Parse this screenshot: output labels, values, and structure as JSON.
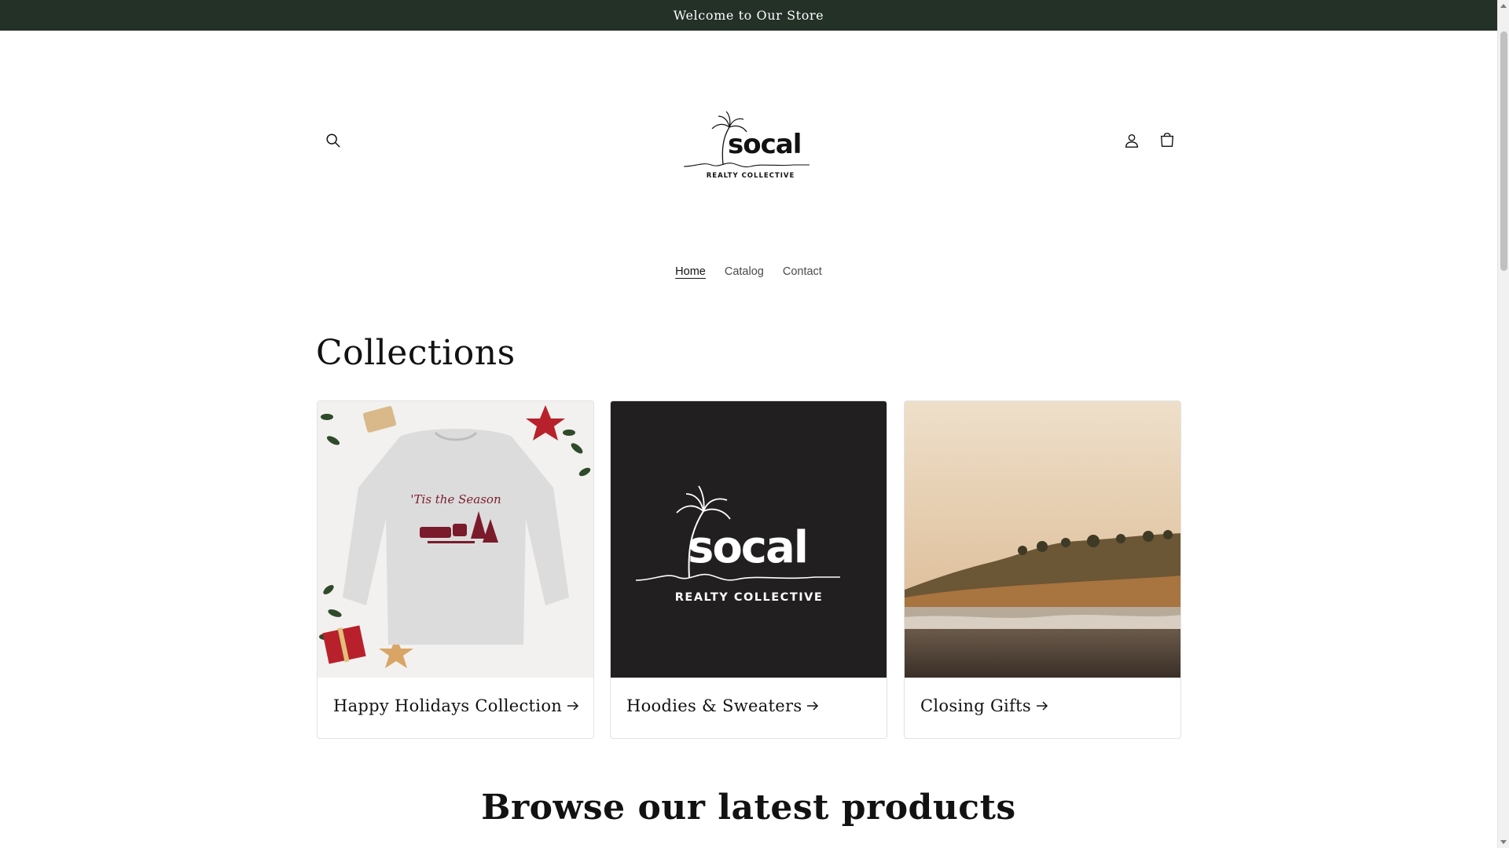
{
  "announcement": {
    "text": "Welcome to Our Store"
  },
  "header": {
    "search_icon": "search-icon",
    "account_icon": "account-icon",
    "cart_icon": "cart-icon",
    "logo": {
      "brand": "socal",
      "tagline": "REALTY COLLECTIVE"
    }
  },
  "nav": {
    "items": [
      {
        "label": "Home",
        "active": true
      },
      {
        "label": "Catalog",
        "active": false
      },
      {
        "label": "Contact",
        "active": false
      }
    ]
  },
  "collections": {
    "title": "Collections",
    "cards": [
      {
        "label": "Happy Holidays Collection",
        "image_text": "'Tis the Season"
      },
      {
        "label": "Hoodies & Sweaters",
        "image_text": "socal",
        "image_subtext": "REALTY COLLECTIVE"
      },
      {
        "label": "Closing Gifts"
      }
    ]
  },
  "browse": {
    "title": "Browse our latest products"
  },
  "colors": {
    "announcement_bg": "#233127",
    "text": "#121212",
    "card_dark": "#221f20"
  }
}
